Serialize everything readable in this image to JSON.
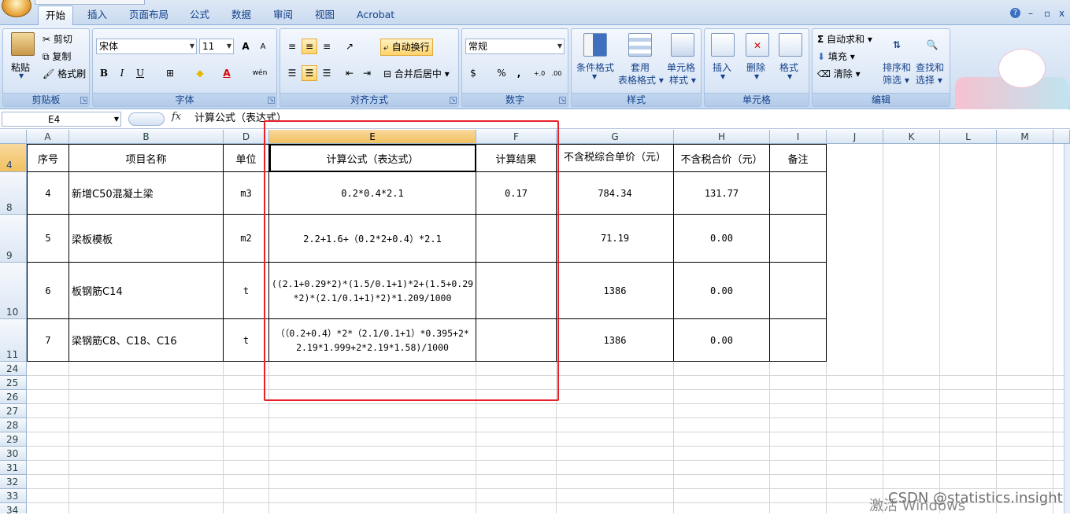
{
  "tabs": [
    {
      "label": "开始",
      "active": true
    },
    {
      "label": "插入"
    },
    {
      "label": "页面布局"
    },
    {
      "label": "公式"
    },
    {
      "label": "数据"
    },
    {
      "label": "审阅"
    },
    {
      "label": "视图"
    },
    {
      "label": "Acrobat"
    }
  ],
  "window_controls": {
    "help": "?",
    "minimize": "–",
    "restore": "▫",
    "close": "x"
  },
  "ribbon": {
    "clipboard": {
      "label": "剪贴板",
      "paste": "粘贴",
      "cut": "剪切",
      "copy": "复制",
      "format_painter": "格式刷"
    },
    "font": {
      "label": "字体",
      "font_name": "宋体",
      "font_size": "11",
      "bold": "B",
      "italic": "I",
      "underline": "U",
      "grow": "A",
      "shrink": "A",
      "phonetic": "wén"
    },
    "alignment": {
      "label": "对齐方式",
      "wrap_text": "自动换行",
      "merge_center": "合并后居中"
    },
    "number": {
      "label": "数字",
      "format": "常规",
      "percent": "%",
      "comma": ",",
      "inc_decimal": "+.0",
      "dec_decimal": ".00"
    },
    "styles": {
      "label": "样式",
      "conditional": "条件格式",
      "table_format_1": "套用",
      "table_format_2": "表格格式",
      "cell_styles_1": "单元格",
      "cell_styles_2": "样式"
    },
    "cells": {
      "label": "单元格",
      "insert": "插入",
      "delete": "删除",
      "format": "格式"
    },
    "editing": {
      "label": "编辑",
      "autosum": "自动求和",
      "fill": "填充",
      "clear": "清除",
      "sort_1": "排序和",
      "sort_2": "筛选",
      "find_1": "查找和",
      "find_2": "选择"
    }
  },
  "formula_bar": {
    "name_box": "E4",
    "fx": "fx",
    "content": "计算公式（表达式）"
  },
  "columns": [
    "A",
    "B",
    "D",
    "E",
    "F",
    "G",
    "H",
    "I",
    "J",
    "K",
    "L",
    "M"
  ],
  "header_row": {
    "row": "4",
    "cells": [
      "序号",
      "项目名称",
      "单位",
      "计算公式（表达式）",
      "计算结果",
      "不含税综合单价（元）",
      "不含税合价（元）",
      "备注"
    ]
  },
  "data_rows": [
    {
      "row": "8",
      "seq": "4",
      "name": "新增C50混凝土梁",
      "unit": "m3",
      "formula": "0.2*0.4*2.1",
      "result": "0.17",
      "unit_price": "784.34",
      "total": "131.77",
      "note": ""
    },
    {
      "row": "9",
      "seq": "5",
      "name": "梁板模板",
      "unit": "m2",
      "formula": "2.2+1.6+（0.2*2+0.4）*2.1",
      "result": "",
      "unit_price": "71.19",
      "total": "0.00",
      "note": ""
    },
    {
      "row": "10",
      "seq": "6",
      "name": "板钢筋C14",
      "unit": "t",
      "formula": "((2.1+0.29*2)*(1.5/0.1+1)*2+(1.5+0.29*2)*(2.1/0.1+1)*2)*1.209/1000",
      "result": "",
      "unit_price": "1386",
      "total": "0.00",
      "note": ""
    },
    {
      "row": "11",
      "seq": "7",
      "name": "梁钢筋C8、C18、C16",
      "unit": "t",
      "formula": "（（0.2+0.4）*2*（2.1/0.1+1）*0.395+2*2.19*1.999+2*2.19*1.58)/1000",
      "result": "",
      "unit_price": "1386",
      "total": "0.00",
      "note": ""
    }
  ],
  "empty_rows": [
    "24",
    "25",
    "26",
    "27",
    "28",
    "29",
    "30",
    "31",
    "32",
    "33",
    "34"
  ],
  "watermark": {
    "activate": "激活 Windows",
    "csdn": "CSDN @statistics.insight"
  },
  "colors": {
    "ribbon": "#d3e1f3",
    "selection": "#f1c15f",
    "annotation_box": "#e8212b"
  }
}
